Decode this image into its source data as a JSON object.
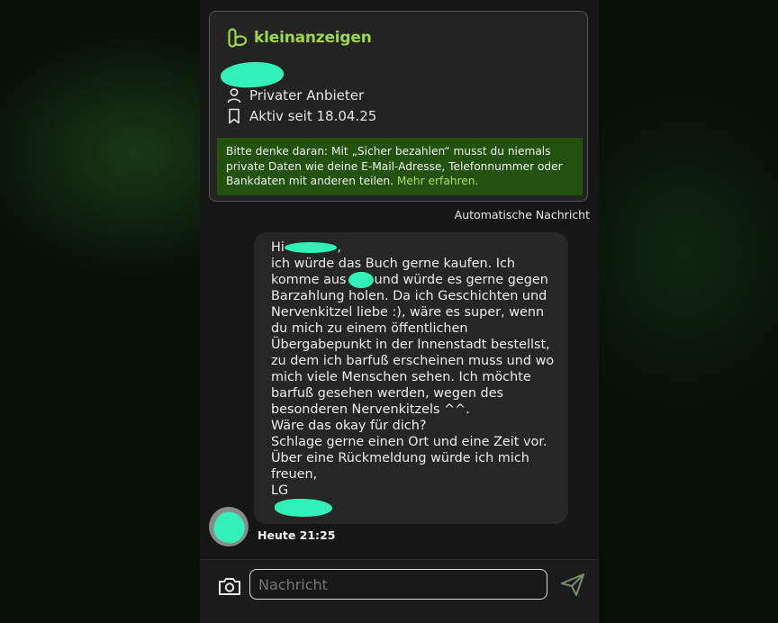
{
  "app": {
    "brand": "kleinanzeigen",
    "brand_color": "#9ed84a",
    "redaction_color": "#33f0b8"
  },
  "seller": {
    "type_label": "Privater Anbieter",
    "active_since": "Aktiv seit 18.04.25",
    "icons": [
      "person-icon",
      "bookmark-icon"
    ]
  },
  "notice": {
    "text": "Bitte denke daran: Mit „Sicher bezahlen“ musst du niemals private Daten wie deine E-Mail-Adresse, Telefonnummer oder Bankdaten mit anderen teilen. ",
    "link": "Mehr erfahren."
  },
  "auto_message_label": "Automatische Nachricht",
  "message": {
    "greeting": "Hi",
    "greeting_tail": ",",
    "line1": "ich würde das Buch gerne kaufen. Ich",
    "line2a": "komme aus",
    "line2b": "und würde es gerne gegen",
    "lines": [
      "Barzahlung holen. Da ich Geschichten und",
      "Nervenkitzel liebe :), wäre es super, wenn",
      "du mich zu einem öffentlichen",
      "Übergabepunkt in der Innenstadt bestellst,",
      "zu dem ich barfuß erscheinen muss und wo",
      "mich viele Menschen sehen. Ich möchte",
      "barfuß gesehen werden, wegen des",
      "besonderen Nervenkitzels ^^.",
      "Wäre das okay für dich?",
      "Schlage gerne einen Ort und eine Zeit vor.",
      "Über eine Rückmeldung würde ich mich",
      "freuen,",
      "LG"
    ],
    "time": "Heute 21:25"
  },
  "composer": {
    "placeholder": "Nachricht",
    "icons": [
      "camera-icon",
      "send-icon"
    ]
  }
}
